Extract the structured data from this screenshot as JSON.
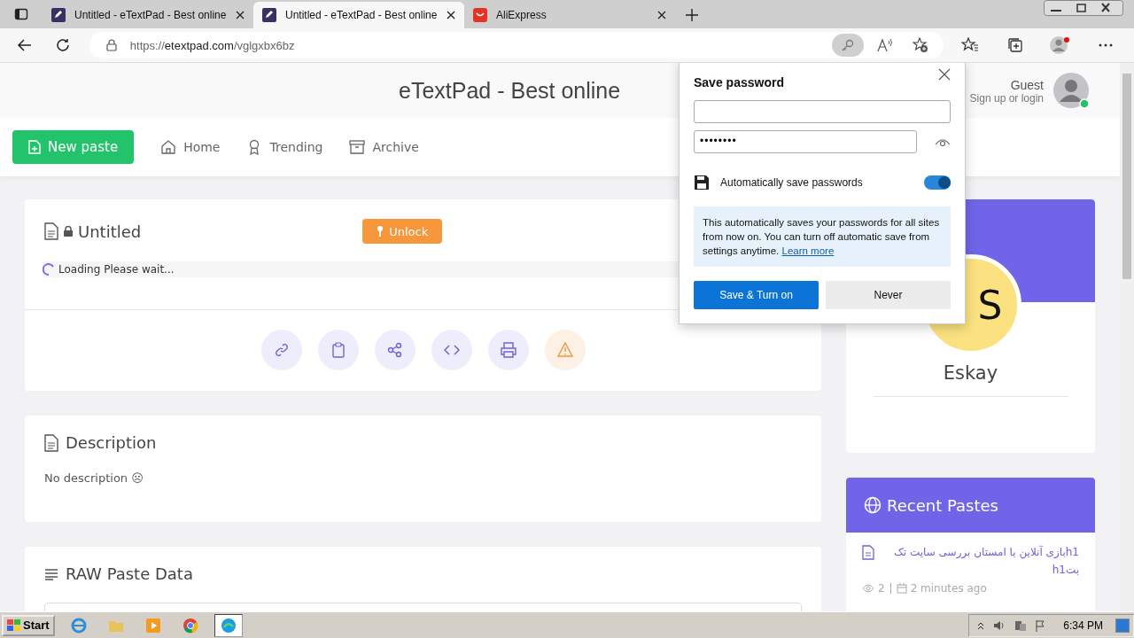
{
  "browser": {
    "tabs": [
      {
        "title": "Untitled - eTextPad - Best online",
        "selected": false,
        "kind": "site"
      },
      {
        "title": "Untitled - eTextPad - Best online",
        "selected": true,
        "kind": "site"
      },
      {
        "title": "AliExpress",
        "selected": false,
        "kind": "shop"
      }
    ],
    "url": {
      "scheme": "https://",
      "host": "etextpad.com",
      "path": "/vglgxbx6bz"
    }
  },
  "header": {
    "title": "eTextPad - Best online",
    "user": "Guest",
    "user_hint": "Sign up or login"
  },
  "nav": {
    "new_button": "New paste",
    "links": [
      "Home",
      "Trending",
      "Archive"
    ]
  },
  "paste": {
    "title": "Untitled",
    "unlock": "Unlock",
    "loading": "Loading Please wait..."
  },
  "description": {
    "heading": "Description",
    "text": "No description ☹"
  },
  "raw": {
    "heading": "RAW Paste Data"
  },
  "profile": {
    "initials": "S",
    "name": "Eskay"
  },
  "recent": {
    "heading": "Recent Pastes",
    "items": [
      {
        "title": "h1بازی آنلاین با امستان بررسی سایت تک بتh1",
        "views": "2",
        "time": "2 minutes ago"
      }
    ]
  },
  "popup": {
    "title": "Save password",
    "password": "••••••••",
    "auto_label": "Automatically save passwords",
    "auto_on": true,
    "info": "This automatically saves your passwords for all sites from now on. You can turn off automatic save from settings anytime.",
    "link": "Learn more",
    "primary": "Save & Turn on",
    "secondary": "Never"
  },
  "taskbar": {
    "start": "Start",
    "clock": "6:34 PM"
  }
}
